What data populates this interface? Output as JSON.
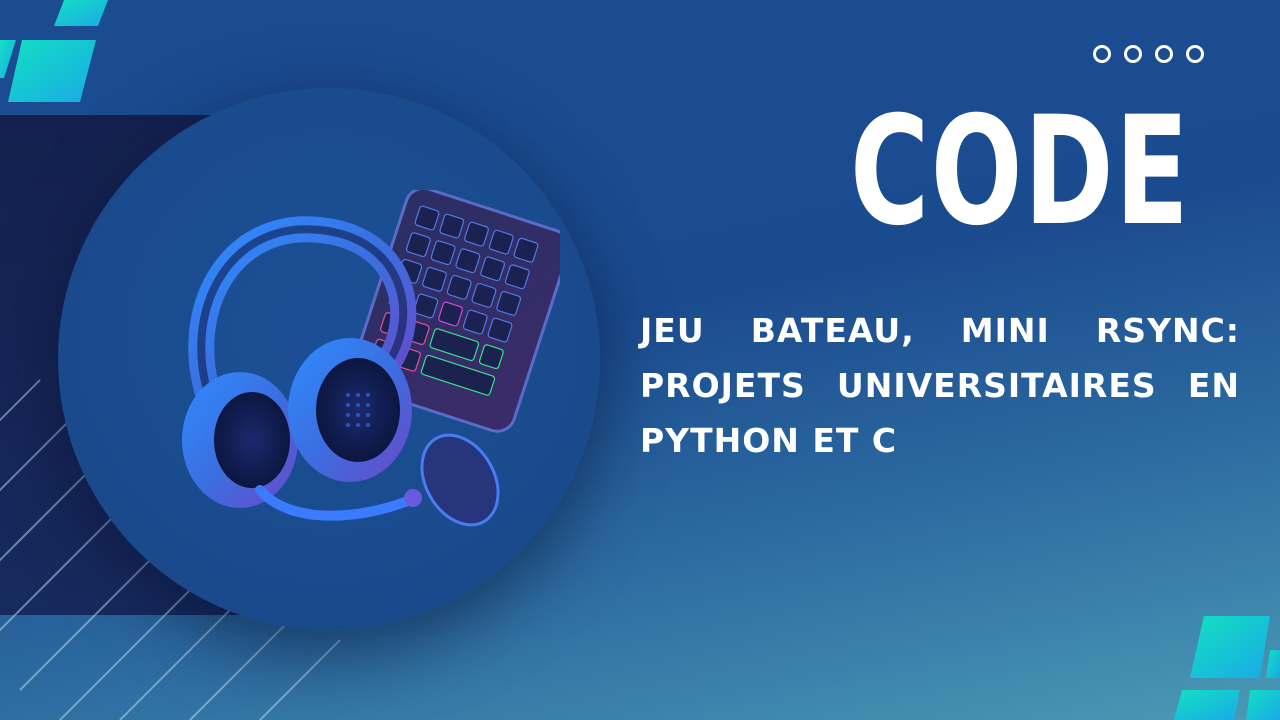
{
  "slide": {
    "title": "CODE",
    "subtitle": "JEU BATEAU, MINI RSYNC: PROJETS UNIVERSITAIRES EN PYTHON ET C",
    "dots_count": 4
  },
  "illustration": {
    "subject": "gaming headset, keyboard and mouse",
    "icon": "gaming-gear-icon"
  },
  "colors": {
    "background": "#1b4c92",
    "dark_panel": "#14214f",
    "accent_teal": "#12d3c9",
    "accent_cyan": "#1fb6e8",
    "text": "#ffffff"
  }
}
